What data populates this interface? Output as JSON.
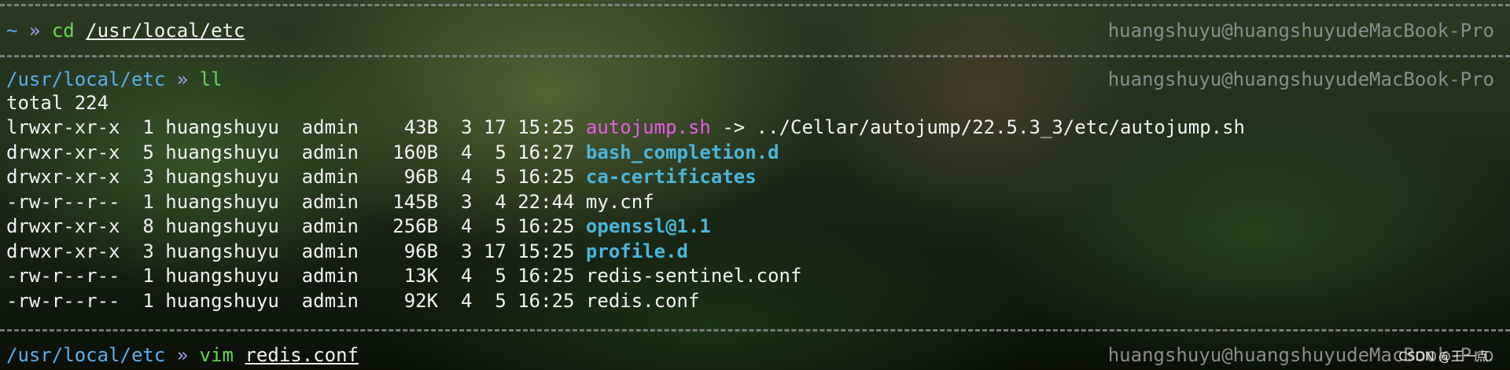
{
  "host": "huangshuyu@huangshuyudeMacBook-Pro",
  "prompts": [
    {
      "cwd": "~",
      "sep": "»",
      "cmd": "cd",
      "arg": "/usr/local/etc"
    },
    {
      "cwd": "/usr/local/etc",
      "sep": "»",
      "cmd": "ll",
      "arg": ""
    },
    {
      "cwd": "/usr/local/etc",
      "sep": "»",
      "cmd": "vim",
      "arg": "redis.conf"
    }
  ],
  "total": "total 224",
  "entries": [
    {
      "meta": "lrwxr-xr-x  1 huangshuyu  admin    43B  3 17 15:25 ",
      "name": "autojump.sh",
      "type": "link",
      "target": " -> ../Cellar/autojump/22.5.3_3/etc/autojump.sh"
    },
    {
      "meta": "drwxr-xr-x  5 huangshuyu  admin   160B  4  5 16:27 ",
      "name": "bash_completion.d",
      "type": "dir"
    },
    {
      "meta": "drwxr-xr-x  3 huangshuyu  admin    96B  4  5 16:25 ",
      "name": "ca-certificates",
      "type": "dir"
    },
    {
      "meta": "-rw-r--r--  1 huangshuyu  admin   145B  3  4 22:44 ",
      "name": "my.cnf",
      "type": "file"
    },
    {
      "meta": "drwxr-xr-x  8 huangshuyu  admin   256B  4  5 16:25 ",
      "name": "openssl@1.1",
      "type": "dir"
    },
    {
      "meta": "drwxr-xr-x  3 huangshuyu  admin    96B  3 17 15:25 ",
      "name": "profile.d",
      "type": "dir"
    },
    {
      "meta": "-rw-r--r--  1 huangshuyu  admin    13K  4  5 16:25 ",
      "name": "redis-sentinel.conf",
      "type": "file"
    },
    {
      "meta": "-rw-r--r--  1 huangshuyu  admin    92K  4  5 16:25 ",
      "name": "redis.conf",
      "type": "file"
    }
  ],
  "watermark": "CSDN @王一点.",
  "colors": {
    "cwd": "#5aaef0",
    "sep": "#a99cf2",
    "cmd": "#6bd35b",
    "link": "#e65ce6",
    "dir": "#4ab6dc"
  }
}
